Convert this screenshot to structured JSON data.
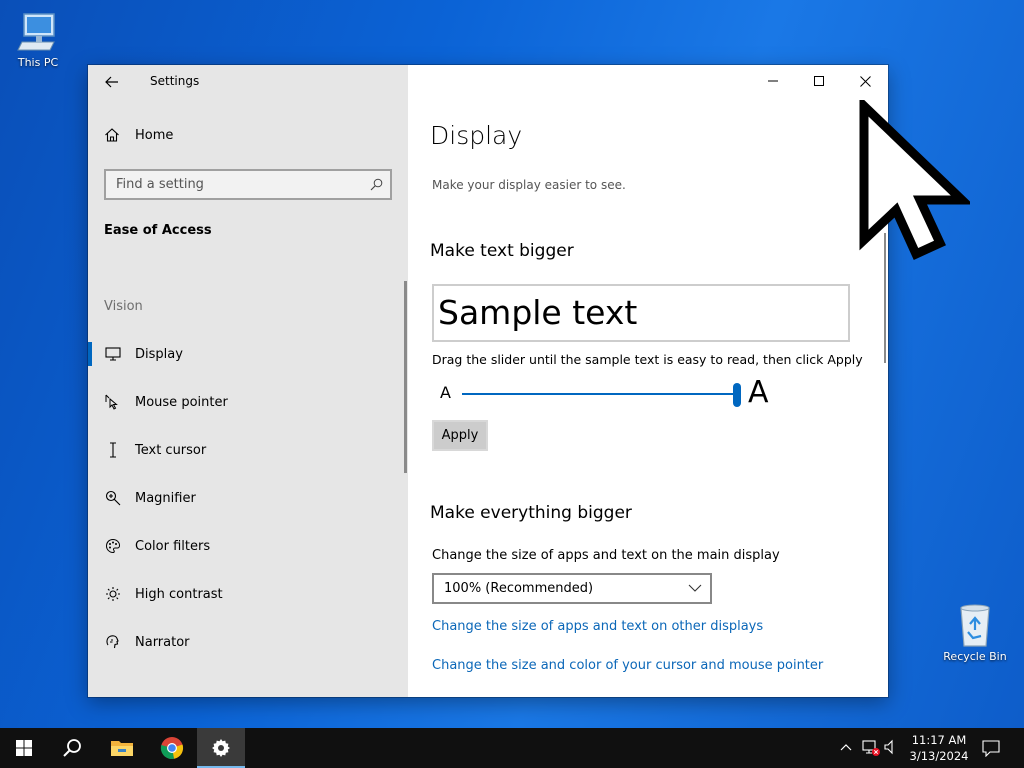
{
  "desktop": {
    "icons": [
      {
        "label": "This PC"
      },
      {
        "label": "Recycle Bin"
      }
    ]
  },
  "window": {
    "app_title": "Settings",
    "sidebar": {
      "home_label": "Home",
      "search_placeholder": "Find a setting",
      "section_title": "Ease of Access",
      "group_title": "Vision",
      "items": [
        {
          "label": "Display",
          "icon": "monitor-icon",
          "selected": true
        },
        {
          "label": "Mouse pointer",
          "icon": "mouse-pointer-icon"
        },
        {
          "label": "Text cursor",
          "icon": "text-cursor-icon"
        },
        {
          "label": "Magnifier",
          "icon": "magnifier-icon"
        },
        {
          "label": "Color filters",
          "icon": "palette-icon"
        },
        {
          "label": "High contrast",
          "icon": "sun-icon"
        },
        {
          "label": "Narrator",
          "icon": "narrator-icon"
        }
      ]
    },
    "content": {
      "title": "Display",
      "subtitle": "Make your display easier to see.",
      "text_bigger": {
        "heading": "Make text bigger",
        "sample": "Sample text",
        "hint": "Drag the slider until the sample text is easy to read, then click Apply",
        "small_a": "A",
        "big_a": "A",
        "slider_value_fraction": 1.0,
        "apply_label": "Apply"
      },
      "everything_bigger": {
        "heading": "Make everything bigger",
        "label": "Change the size of apps and text on the main display",
        "selected_option": "100% (Recommended)",
        "link1": "Change the size of apps and text on other displays",
        "link2": "Change the size and color of your cursor and mouse pointer"
      }
    }
  },
  "taskbar": {
    "time": "11:17 AM",
    "date": "3/13/2024"
  },
  "colors": {
    "accent": "#0067c0",
    "link": "#0b67b8",
    "sidebar_bg": "#e6e6e6",
    "taskbar_bg": "#101010"
  }
}
